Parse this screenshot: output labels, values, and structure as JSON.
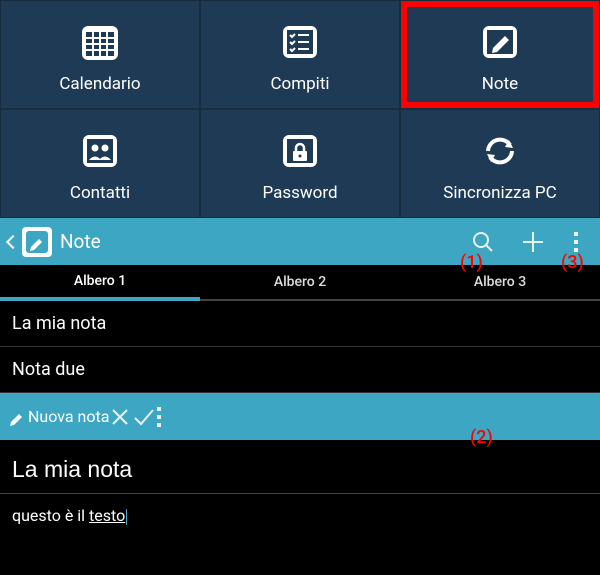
{
  "home": {
    "items": [
      {
        "label": "Calendario"
      },
      {
        "label": "Compiti"
      },
      {
        "label": "Note"
      },
      {
        "label": "Contatti"
      },
      {
        "label": "Password"
      },
      {
        "label": "Sincronizza PC"
      }
    ]
  },
  "noteListToolbar": {
    "title": "Note"
  },
  "tabs": [
    {
      "label": "Albero 1"
    },
    {
      "label": "Albero 2"
    },
    {
      "label": "Albero 3"
    }
  ],
  "notes": [
    {
      "title": "La mia nota"
    },
    {
      "title": "Nota due"
    }
  ],
  "noteEditToolbar": {
    "title": "Nuova nota"
  },
  "editor": {
    "titleValue": "La mia nota",
    "bodyPrefix": "questo è il ",
    "bodyUnderlined": "testo"
  },
  "annotations": {
    "a1": "(1)",
    "a2": "(2)",
    "a3": "(3)"
  }
}
